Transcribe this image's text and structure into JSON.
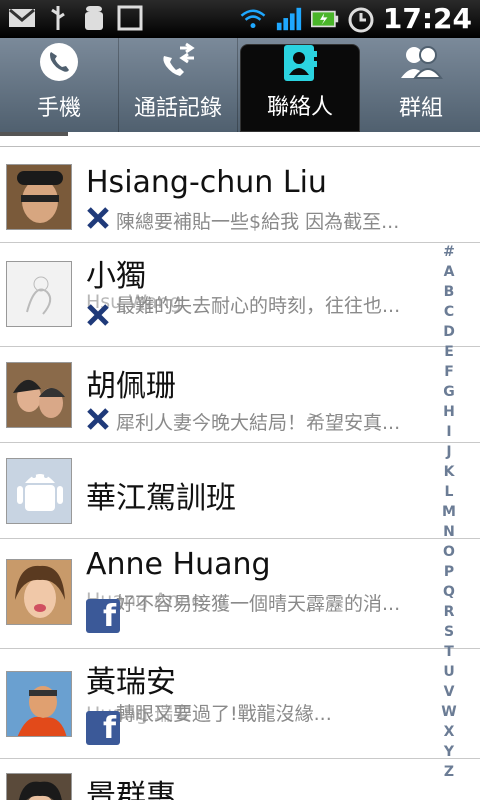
{
  "status_bar": {
    "time": "17:24",
    "left_icons": [
      "gmail-icon",
      "usb-icon",
      "android-debug-icon",
      "screenshot-icon"
    ],
    "right_icons": [
      "wifi-icon",
      "signal-icon",
      "battery-icon",
      "alarm-icon"
    ]
  },
  "tabs": [
    {
      "label": "手機",
      "icon": "phone-icon",
      "active": false
    },
    {
      "label": "通話記錄",
      "icon": "call-log-icon",
      "active": false
    },
    {
      "label": "聯絡人",
      "icon": "contacts-icon",
      "active": true
    },
    {
      "label": "群組",
      "icon": "group-icon",
      "active": false
    }
  ],
  "contacts": [
    {
      "name": "Hsiang-chun Liu",
      "status": "陳總要補貼一些$給我 因為截至...",
      "source": "x-icon"
    },
    {
      "name": "小獨",
      "status": "最難的失去耐心的時刻，往往也...",
      "ghost": "Hsu Wang",
      "source": "x-icon"
    },
    {
      "name": "胡佩珊",
      "status": "犀利人妻今晚大結局！希望安真...",
      "source": "x-icon"
    },
    {
      "name": "華江駕訓班",
      "status": "",
      "source": ""
    },
    {
      "name": "Anne Huang",
      "status": "好不容易接獲一個晴天霹靂的消...",
      "ghost": "Huang Anne",
      "source": "facebook-icon"
    },
    {
      "name": "黃瑞安",
      "status": "轉眼又要過了!戰龍沒緣...",
      "ghost": "Huang 瑞安",
      "source": "facebook-icon"
    },
    {
      "name": "景群惠",
      "status": "",
      "source": ""
    }
  ],
  "alpha_index": [
    "#",
    "A",
    "B",
    "C",
    "D",
    "E",
    "F",
    "G",
    "H",
    "I",
    "J",
    "K",
    "L",
    "M",
    "N",
    "O",
    "P",
    "Q",
    "R",
    "S",
    "T",
    "U",
    "V",
    "W",
    "X",
    "Y",
    "Z"
  ]
}
